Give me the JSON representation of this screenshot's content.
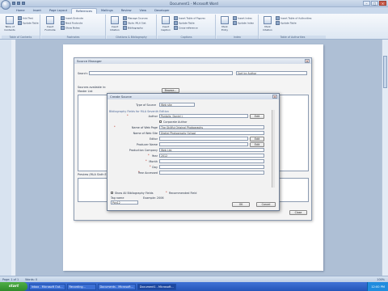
{
  "window": {
    "title": "Document1 - Microsoft Word"
  },
  "tabs": [
    "Home",
    "Insert",
    "Page Layout",
    "References",
    "Mailings",
    "Review",
    "View",
    "Developer"
  ],
  "active_tab": "References",
  "ribbon": {
    "toc": {
      "big": "Table of Contents",
      "small": [
        "Add Text",
        "Update Table"
      ],
      "label": "Table of Contents"
    },
    "footnotes": {
      "big": "Insert Footnote",
      "small": [
        "Insert Endnote",
        "Next Footnote",
        "Show Notes"
      ],
      "label": "Footnotes"
    },
    "citations": {
      "big": "Insert Citation",
      "small": [
        "Manage Sources",
        "Style: MLA Sixt",
        "Bibliography"
      ],
      "label": "Citations & Bibliography"
    },
    "captions": {
      "big": "Insert Caption",
      "small": [
        "Insert Table of Figures",
        "Update Table",
        "Cross-reference"
      ],
      "label": "Captions"
    },
    "index": {
      "big": "Mark Entry",
      "small": [
        "Insert Index",
        "Update Index"
      ],
      "label": "Index"
    },
    "toa": {
      "big": "Mark Citation",
      "small": [
        "Insert Table of Authorities",
        "Update Table"
      ],
      "label": "Table of Authorities"
    }
  },
  "source_manager": {
    "title": "Source Manager",
    "search_label": "Search:",
    "search_value": "",
    "sort_value": "Sort by Author",
    "sources_available_label": "Sources available in:",
    "master_list_label": "Master List",
    "browse_label": "Browse...",
    "preview_label": "Preview (MLA Sixth Edition):",
    "close_label": "Close"
  },
  "create_source": {
    "title": "Create Source",
    "type_label": "Type of Source",
    "type_value": "Web site",
    "fields_hint": "Bibliography Fields for MLA Seventh Edition",
    "fields": [
      {
        "label": "Author",
        "value": "Pontalis, Daniel J.",
        "required": true,
        "edit": true
      },
      {
        "label": "",
        "value": "Corporate Author",
        "checkbox": true
      },
      {
        "label": "Name of Web Page",
        "value": "The Skillful Original Photographs",
        "required": true
      },
      {
        "label": "Name of Web Site",
        "value": "Digital Photography School",
        "required": false
      },
      {
        "label": "Editor",
        "value": "",
        "edit": true
      },
      {
        "label": "Producer Name",
        "value": "",
        "edit": true
      },
      {
        "label": "Production Company",
        "value": "Web Ltd.",
        "required": false
      },
      {
        "label": "Year",
        "value": "2012",
        "required": true
      },
      {
        "label": "Month",
        "value": "",
        "required": true
      },
      {
        "label": "Day",
        "value": "",
        "required": true
      },
      {
        "label": "Year Accessed",
        "value": "",
        "required": true
      }
    ],
    "show_all_label": "Show All Bibliography Fields",
    "recommended_label": "Recommended Field",
    "tag_name_label": "Tag name",
    "example_label": "Example: 2006",
    "tag_value": "Pon12",
    "ok_label": "OK",
    "cancel_label": "Cancel"
  },
  "status": {
    "page": "Page: 1 of 1",
    "words": "Words: 0",
    "zoom": "100%"
  },
  "taskbar": {
    "start": "start",
    "tasks": [
      "Inbox - Microsoft Out...",
      "Recording...",
      "Documents - Microsoft...",
      "Document1 - Microsoft..."
    ],
    "active_task": 3,
    "time": "12:00 PM"
  }
}
